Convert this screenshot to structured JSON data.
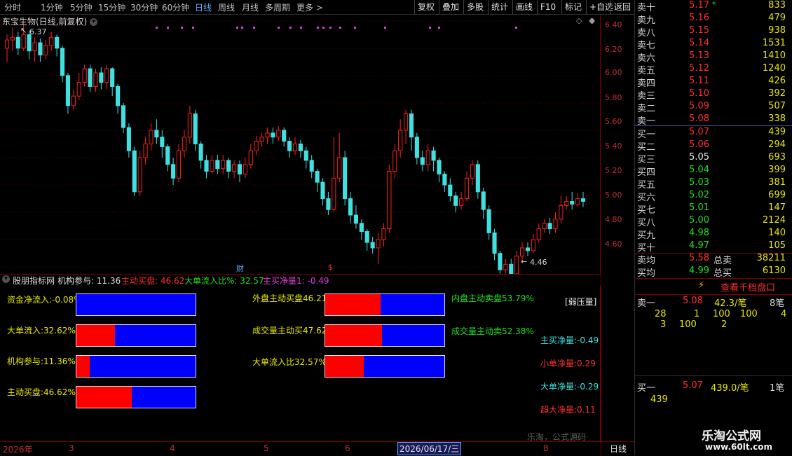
{
  "toolbar": {
    "periods": [
      "分时",
      "1分钟",
      "5分钟",
      "15分钟",
      "30分钟",
      "60分钟",
      "日线",
      "周线",
      "月线",
      "多周期",
      "更多 >"
    ],
    "active_period": "日线",
    "buttons": [
      "复权",
      "叠加",
      "多股",
      "统计",
      "画线",
      "F10",
      "标记",
      "+自选",
      "返回"
    ]
  },
  "chart": {
    "title": "东宝生物(日线,前复权)",
    "high_marker": "6.37",
    "low_marker": "4.46",
    "cai_marker": "财",
    "dollar_marker": "$",
    "y_ticks": [
      "6.40",
      "6.20",
      "6.00",
      "5.80",
      "5.60",
      "5.40",
      "5.20",
      "5.00",
      "4.80",
      "4.60"
    ],
    "up_color": "#ff2020",
    "down_color": "#40e0e0"
  },
  "chart_data": {
    "type": "candlestick",
    "title": "东宝生物(日线,前复权)",
    "ylim": [
      4.55,
      6.45
    ],
    "y_ticks": [
      6.4,
      6.2,
      6.0,
      5.8,
      5.6,
      5.4,
      5.2,
      5.0,
      4.8,
      4.6
    ],
    "x_labels": [
      "2026年",
      "3",
      "4",
      "5",
      "6",
      "2026/06/17/三",
      "8"
    ],
    "candles": [
      [
        6.2,
        6.26,
        6.3,
        6.1
      ],
      [
        6.26,
        6.28,
        6.35,
        6.18
      ],
      [
        6.28,
        6.2,
        6.32,
        6.15
      ],
      [
        6.2,
        6.3,
        6.37,
        6.18
      ],
      [
        6.3,
        6.18,
        6.33,
        6.12
      ],
      [
        6.18,
        6.24,
        6.28,
        6.1
      ],
      [
        6.24,
        6.15,
        6.27,
        6.1
      ],
      [
        6.15,
        6.22,
        6.26,
        6.12
      ],
      [
        6.22,
        6.28,
        6.32,
        6.18
      ],
      [
        6.28,
        6.2,
        6.3,
        6.14
      ],
      [
        6.2,
        6.0,
        6.22,
        5.95
      ],
      [
        6.0,
        5.78,
        6.02,
        5.72
      ],
      [
        5.78,
        5.85,
        5.9,
        5.75
      ],
      [
        5.85,
        5.95,
        6.02,
        5.82
      ],
      [
        5.95,
        6.05,
        6.08,
        5.92
      ],
      [
        6.05,
        5.92,
        6.08,
        5.88
      ],
      [
        5.92,
        6.02,
        6.05,
        5.88
      ],
      [
        6.02,
        5.95,
        6.06,
        5.9
      ],
      [
        5.95,
        6.05,
        6.08,
        5.9
      ],
      [
        6.05,
        5.92,
        6.06,
        5.85
      ],
      [
        5.92,
        5.78,
        5.94,
        5.72
      ],
      [
        5.78,
        5.62,
        5.8,
        5.58
      ],
      [
        5.62,
        5.45,
        5.65,
        5.4
      ],
      [
        5.45,
        5.15,
        5.48,
        5.12
      ],
      [
        5.15,
        5.4,
        5.45,
        5.12
      ],
      [
        5.4,
        5.5,
        5.55,
        5.35
      ],
      [
        5.5,
        5.6,
        5.65,
        5.45
      ],
      [
        5.6,
        5.55,
        5.68,
        5.5
      ],
      [
        5.55,
        5.48,
        5.6,
        5.4
      ],
      [
        5.48,
        5.35,
        5.5,
        5.3
      ],
      [
        5.35,
        5.25,
        5.4,
        5.2
      ],
      [
        5.25,
        5.45,
        5.5,
        5.22
      ],
      [
        5.45,
        5.55,
        5.6,
        5.4
      ],
      [
        5.55,
        5.72,
        5.78,
        5.5
      ],
      [
        5.72,
        5.5,
        5.75,
        5.45
      ],
      [
        5.5,
        5.38,
        5.52,
        5.32
      ],
      [
        5.38,
        5.3,
        5.42,
        5.25
      ],
      [
        5.3,
        5.38,
        5.42,
        5.28
      ],
      [
        5.38,
        5.32,
        5.42,
        5.28
      ],
      [
        5.32,
        5.38,
        5.42,
        5.28
      ],
      [
        5.38,
        5.3,
        5.4,
        5.25
      ],
      [
        5.3,
        5.35,
        5.38,
        5.25
      ],
      [
        5.35,
        5.28,
        5.38,
        5.22
      ],
      [
        5.28,
        5.35,
        5.4,
        5.25
      ],
      [
        5.35,
        5.45,
        5.5,
        5.32
      ],
      [
        5.45,
        5.52,
        5.56,
        5.42
      ],
      [
        5.52,
        5.55,
        5.58,
        5.48
      ],
      [
        5.55,
        5.58,
        5.62,
        5.5
      ],
      [
        5.58,
        5.55,
        5.62,
        5.5
      ],
      [
        5.55,
        5.6,
        5.63,
        5.52
      ],
      [
        5.6,
        5.52,
        5.62,
        5.48
      ],
      [
        5.52,
        5.45,
        5.55,
        5.4
      ],
      [
        5.45,
        5.5,
        5.55,
        5.42
      ],
      [
        5.5,
        5.45,
        5.53,
        5.4
      ],
      [
        5.45,
        5.38,
        5.48,
        5.32
      ],
      [
        5.38,
        5.3,
        5.42,
        5.25
      ],
      [
        5.3,
        5.22,
        5.32,
        5.15
      ],
      [
        5.22,
        5.1,
        5.25,
        5.05
      ],
      [
        5.1,
        5.02,
        5.15,
        4.98
      ],
      [
        5.02,
        5.25,
        5.55,
        5.0
      ],
      [
        5.25,
        5.4,
        5.58,
        5.22
      ],
      [
        5.4,
        5.1,
        5.45,
        5.05
      ],
      [
        5.1,
        4.98,
        5.15,
        4.92
      ],
      [
        4.98,
        4.92,
        5.05,
        4.88
      ],
      [
        4.92,
        4.86,
        4.95,
        4.8
      ],
      [
        4.86,
        4.78,
        4.88,
        4.72
      ],
      [
        4.78,
        4.74,
        4.82,
        4.7
      ],
      [
        4.74,
        4.8,
        4.85,
        4.62
      ],
      [
        4.8,
        4.88,
        4.92,
        4.75
      ],
      [
        4.88,
        5.3,
        5.35,
        4.85
      ],
      [
        5.3,
        5.45,
        5.5,
        5.25
      ],
      [
        5.45,
        5.6,
        5.68,
        5.4
      ],
      [
        5.6,
        5.72,
        5.75,
        5.5
      ],
      [
        5.72,
        5.55,
        5.75,
        5.45
      ],
      [
        5.55,
        5.4,
        5.58,
        5.35
      ],
      [
        5.4,
        5.35,
        5.45,
        5.3
      ],
      [
        5.35,
        5.45,
        5.5,
        5.3
      ],
      [
        5.45,
        5.38,
        5.48,
        5.3
      ],
      [
        5.38,
        5.28,
        5.4,
        5.22
      ],
      [
        5.28,
        5.2,
        5.3,
        5.15
      ],
      [
        5.2,
        5.12,
        5.25,
        5.08
      ],
      [
        5.12,
        5.05,
        5.15,
        5.0
      ],
      [
        5.05,
        5.1,
        5.15,
        5.02
      ],
      [
        5.1,
        5.25,
        5.3,
        5.08
      ],
      [
        5.25,
        5.35,
        5.38,
        5.2
      ],
      [
        5.35,
        5.15,
        5.38,
        5.1
      ],
      [
        5.15,
        5.02,
        5.18,
        4.95
      ],
      [
        5.02,
        4.85,
        5.05,
        4.8
      ],
      [
        4.85,
        4.7,
        4.88,
        4.65
      ],
      [
        4.7,
        4.58,
        4.72,
        4.52
      ],
      [
        4.58,
        4.62,
        4.66,
        4.5
      ],
      [
        4.62,
        4.55,
        4.66,
        4.46
      ],
      [
        4.55,
        4.68,
        4.72,
        4.52
      ],
      [
        4.68,
        4.74,
        4.78,
        4.65
      ],
      [
        4.74,
        4.72,
        4.78,
        4.68
      ],
      [
        4.72,
        4.8,
        4.84,
        4.7
      ],
      [
        4.8,
        4.88,
        4.92,
        4.78
      ],
      [
        4.88,
        4.92,
        4.95,
        4.85
      ],
      [
        4.92,
        4.88,
        4.96,
        4.84
      ],
      [
        4.88,
        4.95,
        5.0,
        4.85
      ],
      [
        4.95,
        5.05,
        5.12,
        4.92
      ],
      [
        5.05,
        5.08,
        5.12,
        5.02
      ],
      [
        5.08,
        5.06,
        5.15,
        5.02
      ],
      [
        5.06,
        5.1,
        5.14,
        5.04
      ],
      [
        5.1,
        5.08,
        5.15,
        5.04
      ]
    ]
  },
  "sub": {
    "title": "股朋指标网",
    "jigou": "机构参与: 11.36",
    "zhudong": "主动买盘: 46.62",
    "dadan": "大单流入比%: 32.57",
    "zhumai": "主买净量1: -0.49",
    "bars": [
      {
        "label": "资金净流入:-0.08%",
        "fill": 0.0,
        "color": "#e8e800"
      },
      {
        "label": "大单流入:32.62%",
        "fill": 0.326,
        "color": "#e8e800"
      },
      {
        "label": "机构参与:11.36%",
        "fill": 0.114,
        "color": "#e8e800"
      },
      {
        "label": "主动买盘:46.62%",
        "fill": 0.466,
        "color": "#e8e800"
      },
      {
        "label": "外盘主动买盘46.21%",
        "fill": 0.462,
        "color": "#e8e800"
      },
      {
        "label": "成交量主动买47.62%",
        "fill": 0.476,
        "color": "#e8e800"
      },
      {
        "label": "大单流入比32.57%",
        "fill": 0.326,
        "color": "#e8e800"
      }
    ],
    "right_labels": [
      {
        "text": "内盘主动卖盘53.79%",
        "color": "#20e020"
      },
      {
        "text": "成交量主动卖52.38%",
        "color": "#20e020"
      }
    ],
    "pressure": "[弱压量]",
    "net": [
      {
        "text": "主买净量:-0.49",
        "color": "#40e0e0"
      },
      {
        "text": "小单净量:0.29",
        "color": "#ff3030"
      },
      {
        "text": "大单净量:-0.29",
        "color": "#40e0e0"
      },
      {
        "text": "超大净量:0.11",
        "color": "#ff3030"
      }
    ],
    "watermark": "乐淘，公式源码"
  },
  "orderbook": {
    "sell": [
      {
        "label": "卖十",
        "price": "5.17",
        "vol": "833",
        "pc": "#ff3030"
      },
      {
        "label": "卖九",
        "price": "5.16",
        "vol": "479",
        "pc": "#ff3030"
      },
      {
        "label": "卖八",
        "price": "5.15",
        "vol": "938",
        "pc": "#ff3030"
      },
      {
        "label": "卖七",
        "price": "5.14",
        "vol": "1531",
        "pc": "#ff3030"
      },
      {
        "label": "卖六",
        "price": "5.13",
        "vol": "1410",
        "pc": "#ff3030"
      },
      {
        "label": "卖五",
        "price": "5.12",
        "vol": "1240",
        "pc": "#ff3030"
      },
      {
        "label": "卖四",
        "price": "5.11",
        "vol": "426",
        "pc": "#ff3030"
      },
      {
        "label": "卖三",
        "price": "5.10",
        "vol": "392",
        "pc": "#ff3030"
      },
      {
        "label": "卖二",
        "price": "5.09",
        "vol": "507",
        "pc": "#ff3030"
      },
      {
        "label": "卖一",
        "price": "5.08",
        "vol": "338",
        "pc": "#ff3030"
      }
    ],
    "buy": [
      {
        "label": "买一",
        "price": "5.07",
        "vol": "439",
        "pc": "#ff3030"
      },
      {
        "label": "买二",
        "price": "5.06",
        "vol": "294",
        "pc": "#ff3030"
      },
      {
        "label": "买三",
        "price": "5.05",
        "vol": "693",
        "pc": "#f0f0f0"
      },
      {
        "label": "买四",
        "price": "5.04",
        "vol": "399",
        "pc": "#20e020"
      },
      {
        "label": "买五",
        "price": "5.03",
        "vol": "381",
        "pc": "#20e020"
      },
      {
        "label": "买六",
        "price": "5.02",
        "vol": "699",
        "pc": "#20e020"
      },
      {
        "label": "买七",
        "price": "5.01",
        "vol": "147",
        "pc": "#20e020"
      },
      {
        "label": "买八",
        "price": "5.00",
        "vol": "2124",
        "pc": "#20e020"
      },
      {
        "label": "买九",
        "price": "4.98",
        "vol": "140",
        "pc": "#20e020"
      },
      {
        "label": "买十",
        "price": "4.97",
        "vol": "105",
        "pc": "#20e020"
      }
    ],
    "avg_sell_label": "卖均",
    "avg_sell": "5.58",
    "total_sell_label": "总卖",
    "total_sell": "38211",
    "avg_buy_label": "买均",
    "avg_buy": "4.99",
    "total_buy_label": "总买",
    "total_buy": "6130",
    "view_all": "查看千档盘口",
    "ask1_label": "卖一",
    "ask1_price": "5.08",
    "ask1_detail": "42.3/笔",
    "ask1_count": "8笔",
    "ask1_rows": [
      [
        "28",
        "1",
        "100",
        "100",
        "4"
      ],
      [
        "3",
        "100",
        "2"
      ]
    ],
    "bid1_label": "买一",
    "bid1_price": "5.07",
    "bid1_detail": "439.0/笔",
    "bid1_count": "1笔",
    "bid1_rows": [
      [
        "439"
      ]
    ],
    "site_name": "乐淘公式网",
    "site_url": "www.60lt.com"
  },
  "dates": [
    "2026年",
    "3",
    "4",
    "5",
    "6",
    "2026/06/17/三",
    "8"
  ],
  "period_label": "日线"
}
